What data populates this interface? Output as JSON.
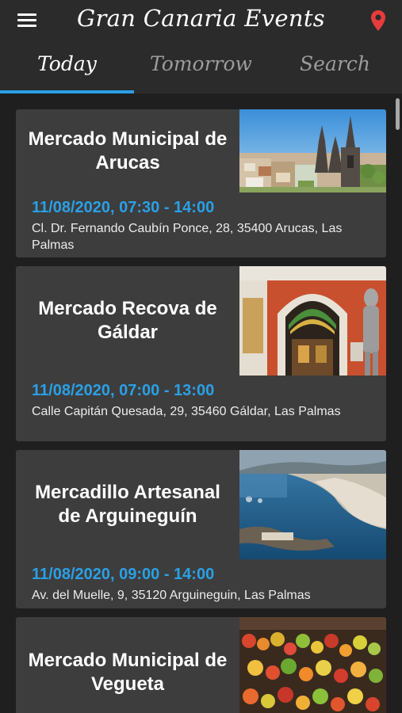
{
  "app": {
    "title": "Gran Canaria Events"
  },
  "tabs": [
    {
      "label": "Today",
      "active": true
    },
    {
      "label": "Tomorrow",
      "active": false
    },
    {
      "label": "Search",
      "active": false
    }
  ],
  "colors": {
    "accent": "#2aa0e6",
    "pin": "#e63c3c",
    "card": "#3d3d3d",
    "background": "#1f1f1f"
  },
  "icons": {
    "menu": "hamburger-menu-icon",
    "location": "map-pin-icon"
  },
  "events": [
    {
      "title": "Mercado Municipal de Arucas",
      "datetime": "11/08/2020, 07:30 - 14:00",
      "address": "Cl. Dr. Fernando Caubín Ponce, 28, 35400 Arucas, Las Palmas"
    },
    {
      "title": "Mercado Recova de Gáldar",
      "datetime": "11/08/2020, 07:00 - 13:00",
      "address": "Calle Capitán Quesada, 29, 35460 Gáldar, Las Palmas"
    },
    {
      "title": "Mercadillo Artesanal de Arguineguín",
      "datetime": "11/08/2020, 09:00 - 14:00",
      "address": "Av. del Muelle, 9, 35120 Arguineguin, Las Palmas"
    },
    {
      "title": "Mercado Municipal de Vegueta",
      "datetime": "",
      "address": ""
    }
  ]
}
